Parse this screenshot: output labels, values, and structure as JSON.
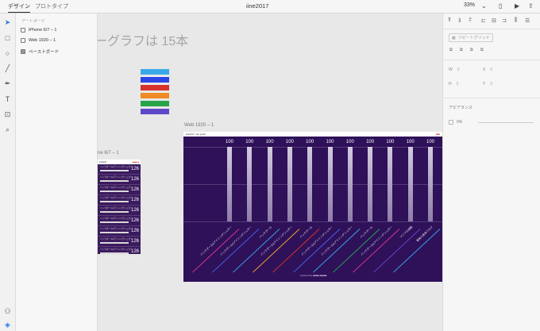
{
  "topbar": {
    "tab_design": "デザイン",
    "tab_prototype": "プロトタイプ",
    "document_title": "iine2017",
    "zoom": "33%"
  },
  "tools": [
    "select-icon",
    "rectangle-icon",
    "ellipse-icon",
    "line-icon",
    "pen-icon",
    "text-icon",
    "artboard-icon",
    "zoom-icon"
  ],
  "layers": {
    "header": "アートボード",
    "items": [
      {
        "label": "iPhone 6/7 – 1"
      },
      {
        "label": "Web 1920 – 1"
      },
      {
        "label": "ペーストボード"
      }
    ]
  },
  "canvas": {
    "heading_fragment": "ーグラフは 15本",
    "swatches": [
      "#39a9e8",
      "#2b45e5",
      "#d9322c",
      "#f08a24",
      "#27a44a",
      "#5e48c9"
    ],
    "iphone_label": "ne 6/7 – 1",
    "web_label": "Web 1920 – 1",
    "iphone": {
      "header_left": "iine2017",
      "header_right": "■■■■ ■",
      "rows": [
        {
          "label": "バッチポール&アイシングシュガー",
          "value": "126"
        },
        {
          "label": "バッチポール&アイシングシュガー",
          "value": "126"
        },
        {
          "label": "バッチポール&アイシングシュガー",
          "value": "126"
        },
        {
          "label": "バッチポール&アイシングシュガー",
          "value": "126"
        },
        {
          "label": "バッチポール&アイシングシュガー",
          "value": "126"
        },
        {
          "label": "バッチポール&アイシングシュガー",
          "value": "126"
        },
        {
          "label": "バッチポール&アイシングシュガー",
          "value": "126"
        },
        {
          "label": "バッチポール&アイシングシュガー",
          "value": "126"
        },
        {
          "label": "バッチポール&アイシングシュガー",
          "value": "126"
        }
      ]
    },
    "web": {
      "header_left": "iine2017 / bar graph",
      "header_right": "■■■",
      "powered": "powered by ■■■■ ■■■■■",
      "colors": [
        "#d7368b",
        "#4661e8",
        "#3aa0e6",
        "#f0a531",
        "#d9322c",
        "#4661e8",
        "#39a9e8",
        "#27a44a",
        "#d7368b",
        "#5e48c9",
        "#3aa0e6"
      ]
    }
  },
  "chart_data": {
    "type": "bar",
    "categories": [
      "バッチポール&アイシングシュガー",
      "バッチポール&アイシングシュガー",
      "バッチポール",
      "バッチポール&アイシングシュガー",
      "バッチポール",
      "バッチポール&アイシングシュガー",
      "バッチポール&アイシングシュガー",
      "バッチポール",
      "バッチポール&アイシングシュガー",
      "マリフロ楽園",
      "最高の長寿フロア"
    ],
    "values": [
      100,
      100,
      100,
      100,
      100,
      100,
      100,
      100,
      100,
      100,
      100
    ]
  },
  "rightpanel": {
    "repeat_grid": "リピートグリッド",
    "w_label": "W",
    "w_value": "0",
    "x_label": "X",
    "x_value": "0",
    "h_label": "H",
    "h_value": "0",
    "y_label": "Y",
    "y_value": "0",
    "appearance": "アピアランス",
    "opacity": "0%"
  }
}
